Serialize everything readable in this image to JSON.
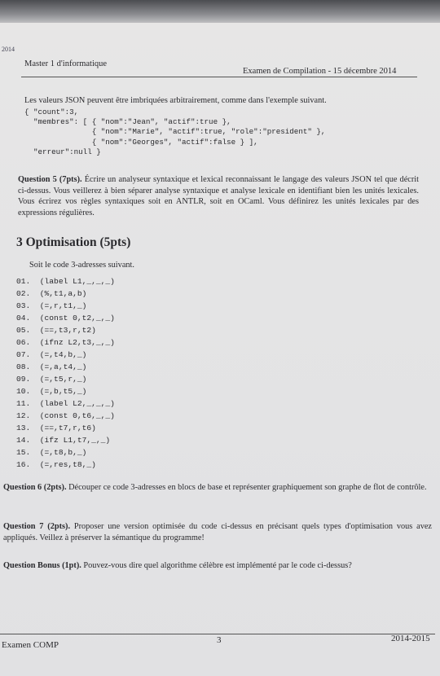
{
  "header": {
    "course": "Master 1 d'informatique",
    "exam": "Examen de Compilation - 15 décembre 2014",
    "margin_year": "2014"
  },
  "json_section": {
    "intro": "Les valeurs JSON peuvent être imbriquées arbitrairement, comme dans l'exemple suivant.",
    "example_lines": [
      "{ \"count\":3,",
      "  \"membres\": [ { \"nom\":\"Jean\", \"actif\":true },",
      "               { \"nom\":\"Marie\", \"actif\":true, \"role\":\"president\" },",
      "               { \"nom\":\"Georges\", \"actif\":false } ],",
      "  \"erreur\":null }"
    ]
  },
  "question5": {
    "label": "Question 5 (7pts).",
    "text": "Écrire un analyseur syntaxique et lexical reconnaissant le langage des valeurs JSON tel que décrit ci-dessus. Vous veillerez à bien séparer analyse syntaxique et analyse lexicale en identifiant bien les unités lexicales. Vous écrirez vos règles syntaxiques soit en ANTLR, soit en OCaml. Vous définirez les unités lexicales par des expressions régulières."
  },
  "section3": {
    "title": "3  Optimisation (5pts)",
    "intro": "Soit le code 3-adresses suivant.",
    "code": [
      "01.  (label L1,_,_,_)",
      "02.  (%,t1,a,b)",
      "03.  (=,r,t1,_)",
      "04.  (const 0,t2,_,_)",
      "05.  (==,t3,r,t2)",
      "06.  (ifnz L2,t3,_,_)",
      "07.  (=,t4,b,_)",
      "08.  (=,a,t4,_)",
      "09.  (=,t5,r,_)",
      "10.  (=,b,t5,_)",
      "11.  (label L2,_,_,_)",
      "12.  (const 0,t6,_,_)",
      "13.  (==,t7,r,t6)",
      "14.  (ifz L1,t7,_,_)",
      "15.  (=,t8,b,_)",
      "16.  (=,res,t8,_)"
    ]
  },
  "question6": {
    "label": "Question 6 (2pts).",
    "text": "Découper ce code 3-adresses en blocs de base et représenter graphiquement son graphe de flot de contrôle."
  },
  "question7": {
    "label": "Question 7 (2pts).",
    "text": "Proposer une version optimisée du code ci-dessus en précisant quels types d'optimisation vous avez appliqués. Veillez à préserver la sémantique du programme!"
  },
  "bonus": {
    "label": "Question Bonus (1pt).",
    "text": "Pouvez-vous dire quel algorithme célèbre est implémenté par le code ci-dessus?"
  },
  "footer": {
    "left": "Examen COMP",
    "page_number": "3",
    "right": "2014-2015"
  }
}
